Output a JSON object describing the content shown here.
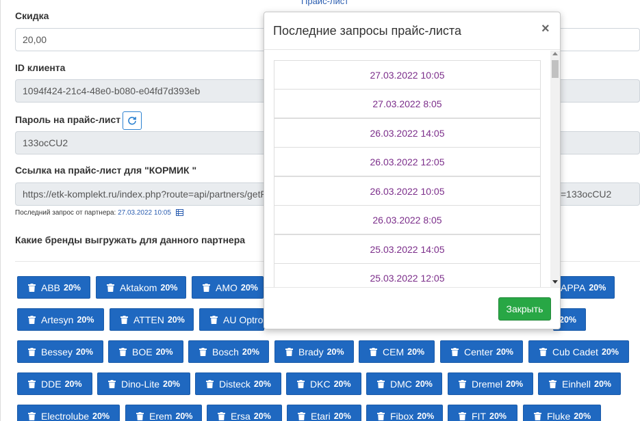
{
  "top_link": "Прайс-лист",
  "form": {
    "discount_label": "Скидка",
    "discount_value": "20,00",
    "client_id_label": "ID клиента",
    "client_id_value": "1094f424-21c4-48e0-b080-e04fd7d393eb",
    "password_label": "Пароль на прайс-лист",
    "password_value": "133ocCU2",
    "link_label": "Ссылка на прайс-лист для \"КОРМИК \"",
    "link_value_left": "https://etk-komplekt.ru/index.php?route=api/partners/getP",
    "link_value_right": "=133ocCU2",
    "last_request_label": "Последний запрос от партнера:",
    "last_request_date": "27.03.2022 10:05",
    "brands_label": "Какие бренды выгружать для данного партнера"
  },
  "brands": [
    {
      "name": "ABB",
      "pct": "20%"
    },
    {
      "name": "Aktakom",
      "pct": "20%"
    },
    {
      "name": "AMO",
      "pct": "20%"
    },
    {
      "name": "APPA",
      "pct": "20%"
    },
    {
      "name": "Artesyn",
      "pct": "20%"
    },
    {
      "name": "ATTEN",
      "pct": "20%"
    },
    {
      "name": "AU Optro",
      "pct": ""
    },
    {
      "name": "",
      "pct": "20%"
    },
    {
      "name": "Bessey",
      "pct": "20%"
    },
    {
      "name": "BOE",
      "pct": "20%"
    },
    {
      "name": "Bosch",
      "pct": "20%"
    },
    {
      "name": "Brady",
      "pct": "20%"
    },
    {
      "name": "CEM",
      "pct": "20%"
    },
    {
      "name": "Center",
      "pct": "20%"
    },
    {
      "name": "Cub Cadet",
      "pct": "20%"
    },
    {
      "name": "DDE",
      "pct": "20%"
    },
    {
      "name": "Dino-Lite",
      "pct": "20%"
    },
    {
      "name": "Disteck",
      "pct": "20%"
    },
    {
      "name": "DKC",
      "pct": "20%"
    },
    {
      "name": "DMC",
      "pct": "20%"
    },
    {
      "name": "Dremel",
      "pct": "20%"
    },
    {
      "name": "Einhell",
      "pct": "20%"
    },
    {
      "name": "Electrolube",
      "pct": "20%"
    },
    {
      "name": "Erem",
      "pct": "20%"
    },
    {
      "name": "Ersa",
      "pct": "20%"
    },
    {
      "name": "Etari",
      "pct": "20%"
    },
    {
      "name": "Fibox",
      "pct": "20%"
    },
    {
      "name": "FIT",
      "pct": "20%"
    },
    {
      "name": "Fluke",
      "pct": "20%"
    }
  ],
  "modal": {
    "title": "Последние запросы прайс-листа",
    "close_symbol": "×",
    "requests": [
      "27.03.2022 10:05",
      "27.03.2022 8:05",
      "26.03.2022 14:05",
      "26.03.2022 12:05",
      "26.03.2022 10:05",
      "26.03.2022 8:05",
      "25.03.2022 14:05",
      "25.03.2022 12:05"
    ],
    "close_button": "Закрыть"
  },
  "colors": {
    "brand_button": "#1f68c0",
    "request_text": "#7b2d8a",
    "close_button": "#28a745",
    "link": "#2a5db0"
  }
}
